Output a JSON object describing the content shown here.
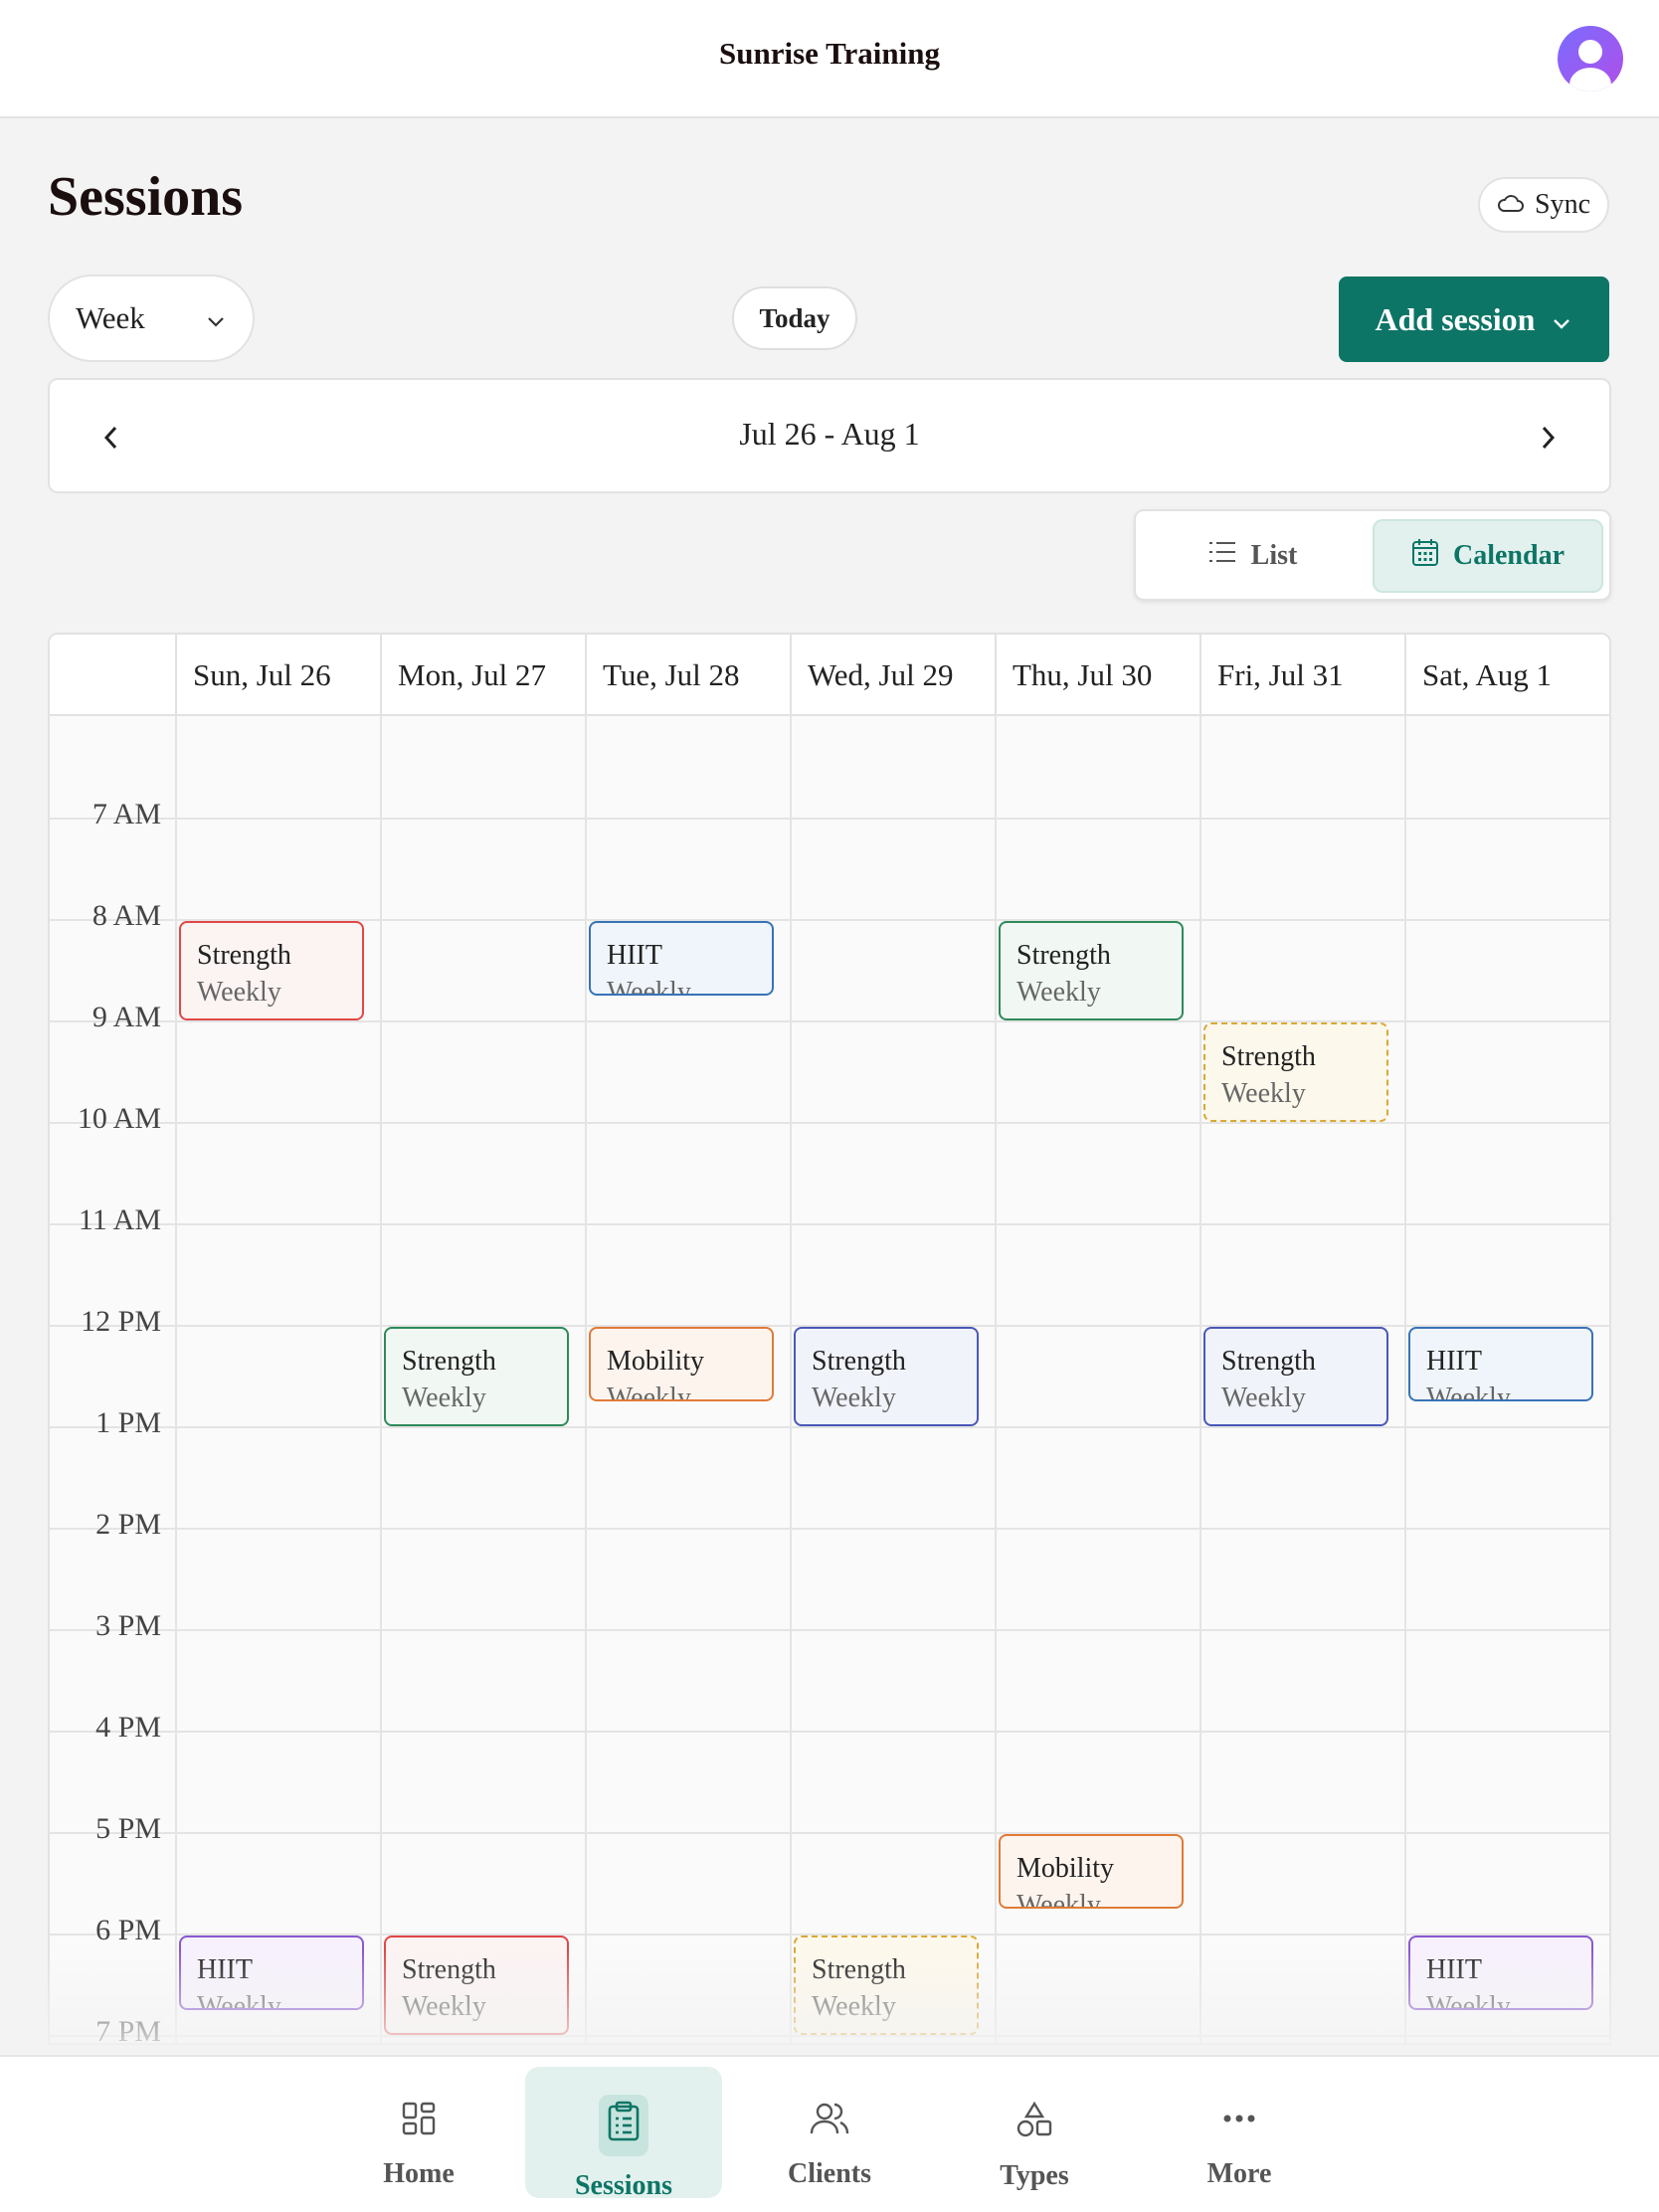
{
  "app": {
    "title": "Sunrise Training"
  },
  "page": {
    "title": "Sessions",
    "sync_label": "Sync",
    "view_select_value": "Week",
    "today_label": "Today",
    "add_label": "Add session",
    "range_label": "Jul 26 - Aug 1"
  },
  "view_toggle": {
    "list_label": "List",
    "calendar_label": "Calendar",
    "active": "Calendar"
  },
  "calendar": {
    "days": [
      "Sun, Jul 26",
      "Mon, Jul 27",
      "Tue, Jul 28",
      "Wed, Jul 29",
      "Thu, Jul 30",
      "Fri, Jul 31",
      "Sat, Aug 1"
    ],
    "hours": [
      "7 AM",
      "8 AM",
      "9 AM",
      "10 AM",
      "11 AM",
      "12 PM",
      "1 PM",
      "2 PM",
      "3 PM",
      "4 PM",
      "5 PM",
      "6 PM",
      "7 PM"
    ],
    "events": [
      {
        "day": 0,
        "start": 8,
        "duration": 1,
        "title": "Strength",
        "recurrence": "Weekly",
        "color": "red"
      },
      {
        "day": 2,
        "start": 8,
        "duration": 0.75,
        "title": "HIIT",
        "recurrence": "Weekly",
        "color": "blue"
      },
      {
        "day": 4,
        "start": 8,
        "duration": 1,
        "title": "Strength",
        "recurrence": "Weekly",
        "color": "green"
      },
      {
        "day": 5,
        "start": 9,
        "duration": 1,
        "title": "Strength",
        "recurrence": "Weekly",
        "color": "gold"
      },
      {
        "day": 1,
        "start": 12,
        "duration": 1,
        "title": "Strength",
        "recurrence": "Weekly",
        "color": "green"
      },
      {
        "day": 2,
        "start": 12,
        "duration": 0.75,
        "title": "Mobility",
        "recurrence": "Weekly",
        "color": "orange"
      },
      {
        "day": 3,
        "start": 12,
        "duration": 1,
        "title": "Strength",
        "recurrence": "Weekly",
        "color": "indigo"
      },
      {
        "day": 5,
        "start": 12,
        "duration": 1,
        "title": "Strength",
        "recurrence": "Weekly",
        "color": "indigo"
      },
      {
        "day": 6,
        "start": 12,
        "duration": 0.75,
        "title": "HIIT",
        "recurrence": "Weekly",
        "color": "blue"
      },
      {
        "day": 4,
        "start": 17,
        "duration": 0.75,
        "title": "Mobility",
        "recurrence": "Weekly",
        "color": "orange"
      },
      {
        "day": 0,
        "start": 18,
        "duration": 0.75,
        "title": "HIIT",
        "recurrence": "Weekly",
        "color": "purple"
      },
      {
        "day": 1,
        "start": 18,
        "duration": 1,
        "title": "Strength",
        "recurrence": "Weekly",
        "color": "red"
      },
      {
        "day": 3,
        "start": 18,
        "duration": 1,
        "title": "Strength",
        "recurrence": "Weekly",
        "color": "gold"
      },
      {
        "day": 6,
        "start": 18,
        "duration": 0.75,
        "title": "HIIT",
        "recurrence": "Weekly",
        "color": "purple"
      }
    ]
  },
  "bottom_nav": {
    "active": "Sessions",
    "items": [
      {
        "label": "Home",
        "icon": "grid-icon"
      },
      {
        "label": "Sessions",
        "icon": "clipboard-icon"
      },
      {
        "label": "Clients",
        "icon": "users-icon"
      },
      {
        "label": "Types",
        "icon": "shapes-icon"
      },
      {
        "label": "More",
        "icon": "more-dots-icon"
      }
    ]
  },
  "colors": {
    "accent": "#0d7566",
    "accent_light": "#e3f1ee"
  }
}
